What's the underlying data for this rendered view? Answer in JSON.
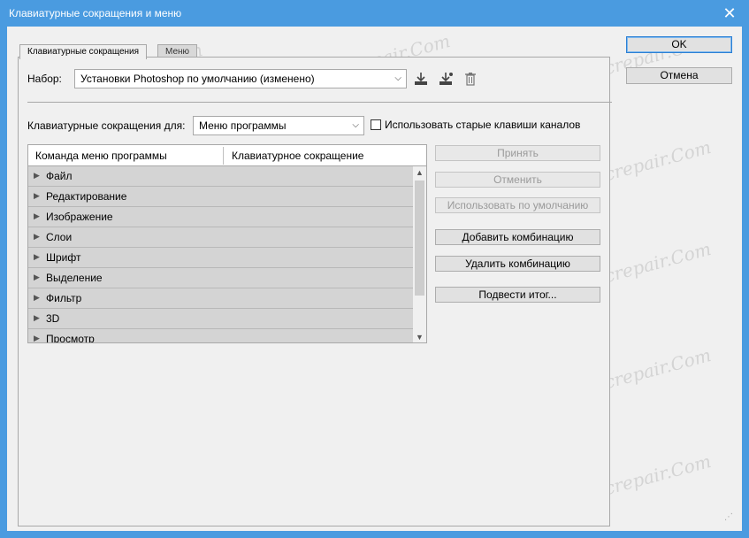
{
  "window": {
    "title": "Клавиатурные сокращения и меню",
    "close_icon": "close-icon"
  },
  "tabs": [
    {
      "label": "Клавиатурные сокращения",
      "active": true
    },
    {
      "label": "Меню",
      "active": false
    }
  ],
  "set": {
    "label": "Набор:",
    "value": "Установки Photoshop по умолчанию (изменено)"
  },
  "shortcuts_for": {
    "label": "Клавиатурные сокращения для:",
    "value": "Меню программы",
    "checkbox_label": "Использовать старые клавиши каналов",
    "checkbox_checked": false
  },
  "table": {
    "col1": "Команда меню программы",
    "col2": "Клавиатурное сокращение",
    "rows": [
      "Файл",
      "Редактирование",
      "Изображение",
      "Слои",
      "Шрифт",
      "Выделение",
      "Фильтр",
      "3D",
      "Просмотр"
    ]
  },
  "buttons": {
    "ok": "OK",
    "cancel": "Отмена",
    "accept": "Принять",
    "undo": "Отменить",
    "use_default": "Использовать по умолчанию",
    "add_shortcut": "Добавить комбинацию",
    "delete_shortcut": "Удалить комбинацию",
    "summarize": "Подвести итог..."
  },
  "watermark": "Soringpcrepair.Com",
  "colors": {
    "titlebar": "#4a9be0",
    "dialog_bg": "#f0f0f0",
    "row_bg": "#d4d4d4"
  }
}
